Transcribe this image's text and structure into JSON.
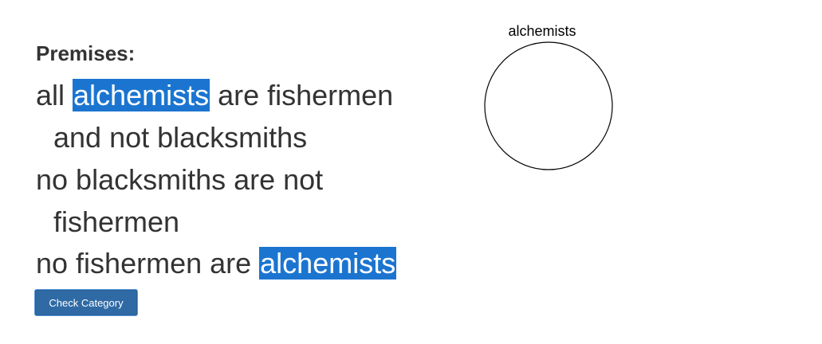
{
  "premises": {
    "heading": "Premises:",
    "items": [
      {
        "line1_prefix": "all ",
        "line1_highlight": "alchemists",
        "line1_suffix": " are fishermen",
        "line2": "and not blacksmiths"
      },
      {
        "line1": "no blacksmiths are not",
        "line2": "fishermen"
      },
      {
        "line1_prefix": "no fishermen are ",
        "line1_highlight": "alchemists"
      }
    ]
  },
  "check_button": {
    "label": "Check Category"
  },
  "venn": {
    "circle_label": "alchemists"
  },
  "colors": {
    "highlight": "#1b75d0",
    "button": "#2f6aa5",
    "text": "#333333"
  }
}
